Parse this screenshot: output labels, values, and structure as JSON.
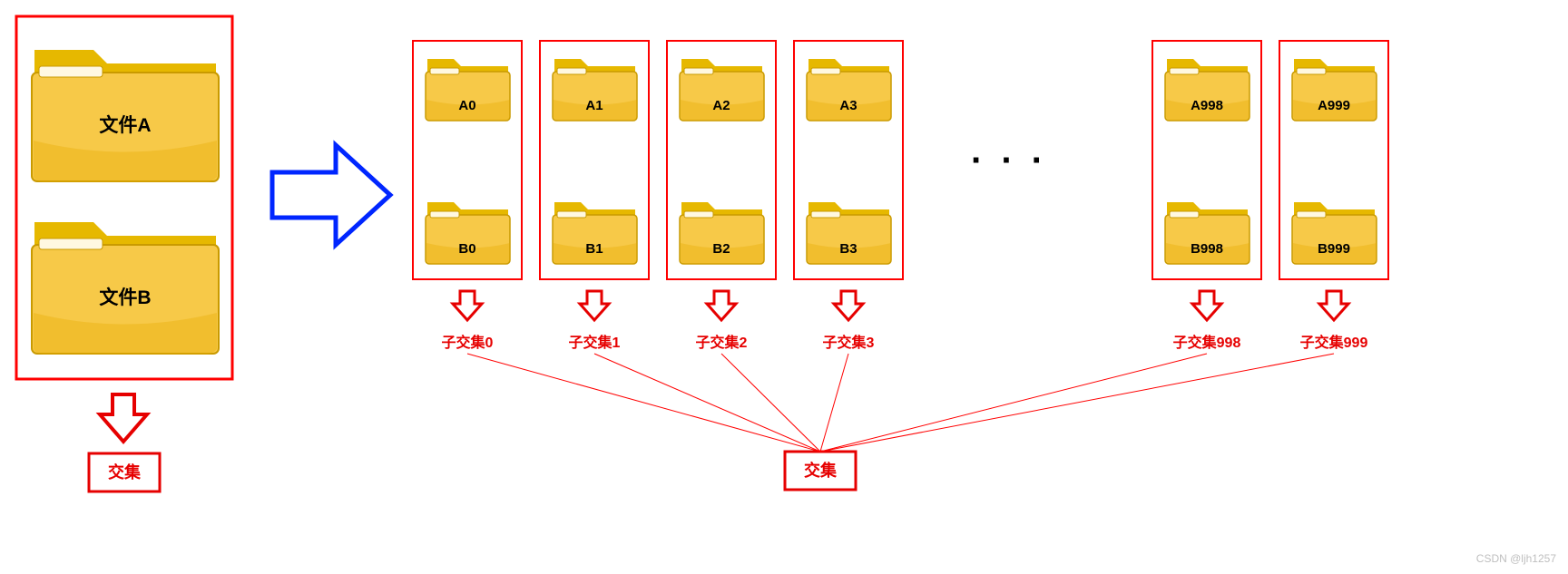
{
  "left": {
    "fileA": "文件A",
    "fileB": "文件B",
    "intersection": "交集"
  },
  "columns": [
    {
      "a": "A0",
      "b": "B0",
      "sub": "子交集0"
    },
    {
      "a": "A1",
      "b": "B1",
      "sub": "子交集1"
    },
    {
      "a": "A2",
      "b": "B2",
      "sub": "子交集2"
    },
    {
      "a": "A3",
      "b": "B3",
      "sub": "子交集3"
    },
    {
      "a": "A998",
      "b": "B998",
      "sub": "子交集998"
    },
    {
      "a": "A999",
      "b": "B999",
      "sub": "子交集999"
    }
  ],
  "right_intersection": "交集",
  "watermark": "CSDN @ljh1257"
}
